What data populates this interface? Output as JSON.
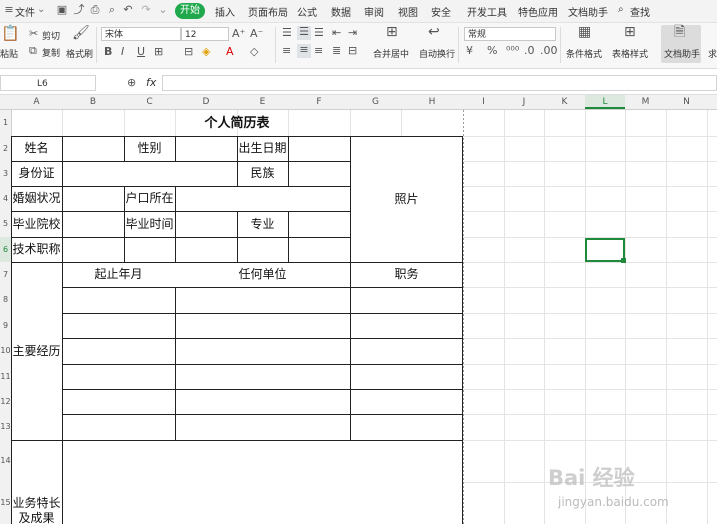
{
  "menubar": {
    "file": "文件",
    "tabs": [
      "开始",
      "插入",
      "页面布局",
      "公式",
      "数据",
      "审阅",
      "视图",
      "安全",
      "开发工具",
      "特色应用",
      "文档助手"
    ],
    "search": "查找",
    "active_color": "#1fa84c"
  },
  "ribbon": {
    "paste": "粘贴",
    "cut": "剪切",
    "copy": "复制",
    "format_painter": "格式刷",
    "font_name": "宋体",
    "font_size": "12",
    "merge_center": "合并居中",
    "wrap_text": "自动换行",
    "number_format": "常规",
    "conditional_format": "条件格式",
    "table_style": "表格样式",
    "doc_assistant": "文档助手",
    "more": "求"
  },
  "formula_bar": {
    "name_box": "L6",
    "fx": "fx",
    "formula": ""
  },
  "columns": [
    "A",
    "B",
    "C",
    "D",
    "E",
    "F",
    "G",
    "H",
    "I",
    "J",
    "K",
    "L",
    "M",
    "N"
  ],
  "rows": [
    "1",
    "2",
    "3",
    "4",
    "5",
    "6",
    "7",
    "8",
    "9",
    "10",
    "11",
    "12",
    "13",
    "14",
    "15"
  ],
  "resume": {
    "title": "个人简历表",
    "name": "姓名",
    "gender": "性别",
    "birth": "出生日期",
    "id": "身份证",
    "ethnic": "民族",
    "photo": "照片",
    "marital": "婚姻状况",
    "hukou": "户口所在",
    "school": "毕业院校",
    "grad_time": "毕业时间",
    "major": "专业",
    "title_rank": "技术职称",
    "main_exp": "主要经历",
    "period": "起止年月",
    "employer": "任何单位",
    "position": "职务",
    "skills": "业务特长及成果"
  },
  "watermark": {
    "brand": "Bai 经验",
    "url": "jingyan.baidu.com"
  }
}
